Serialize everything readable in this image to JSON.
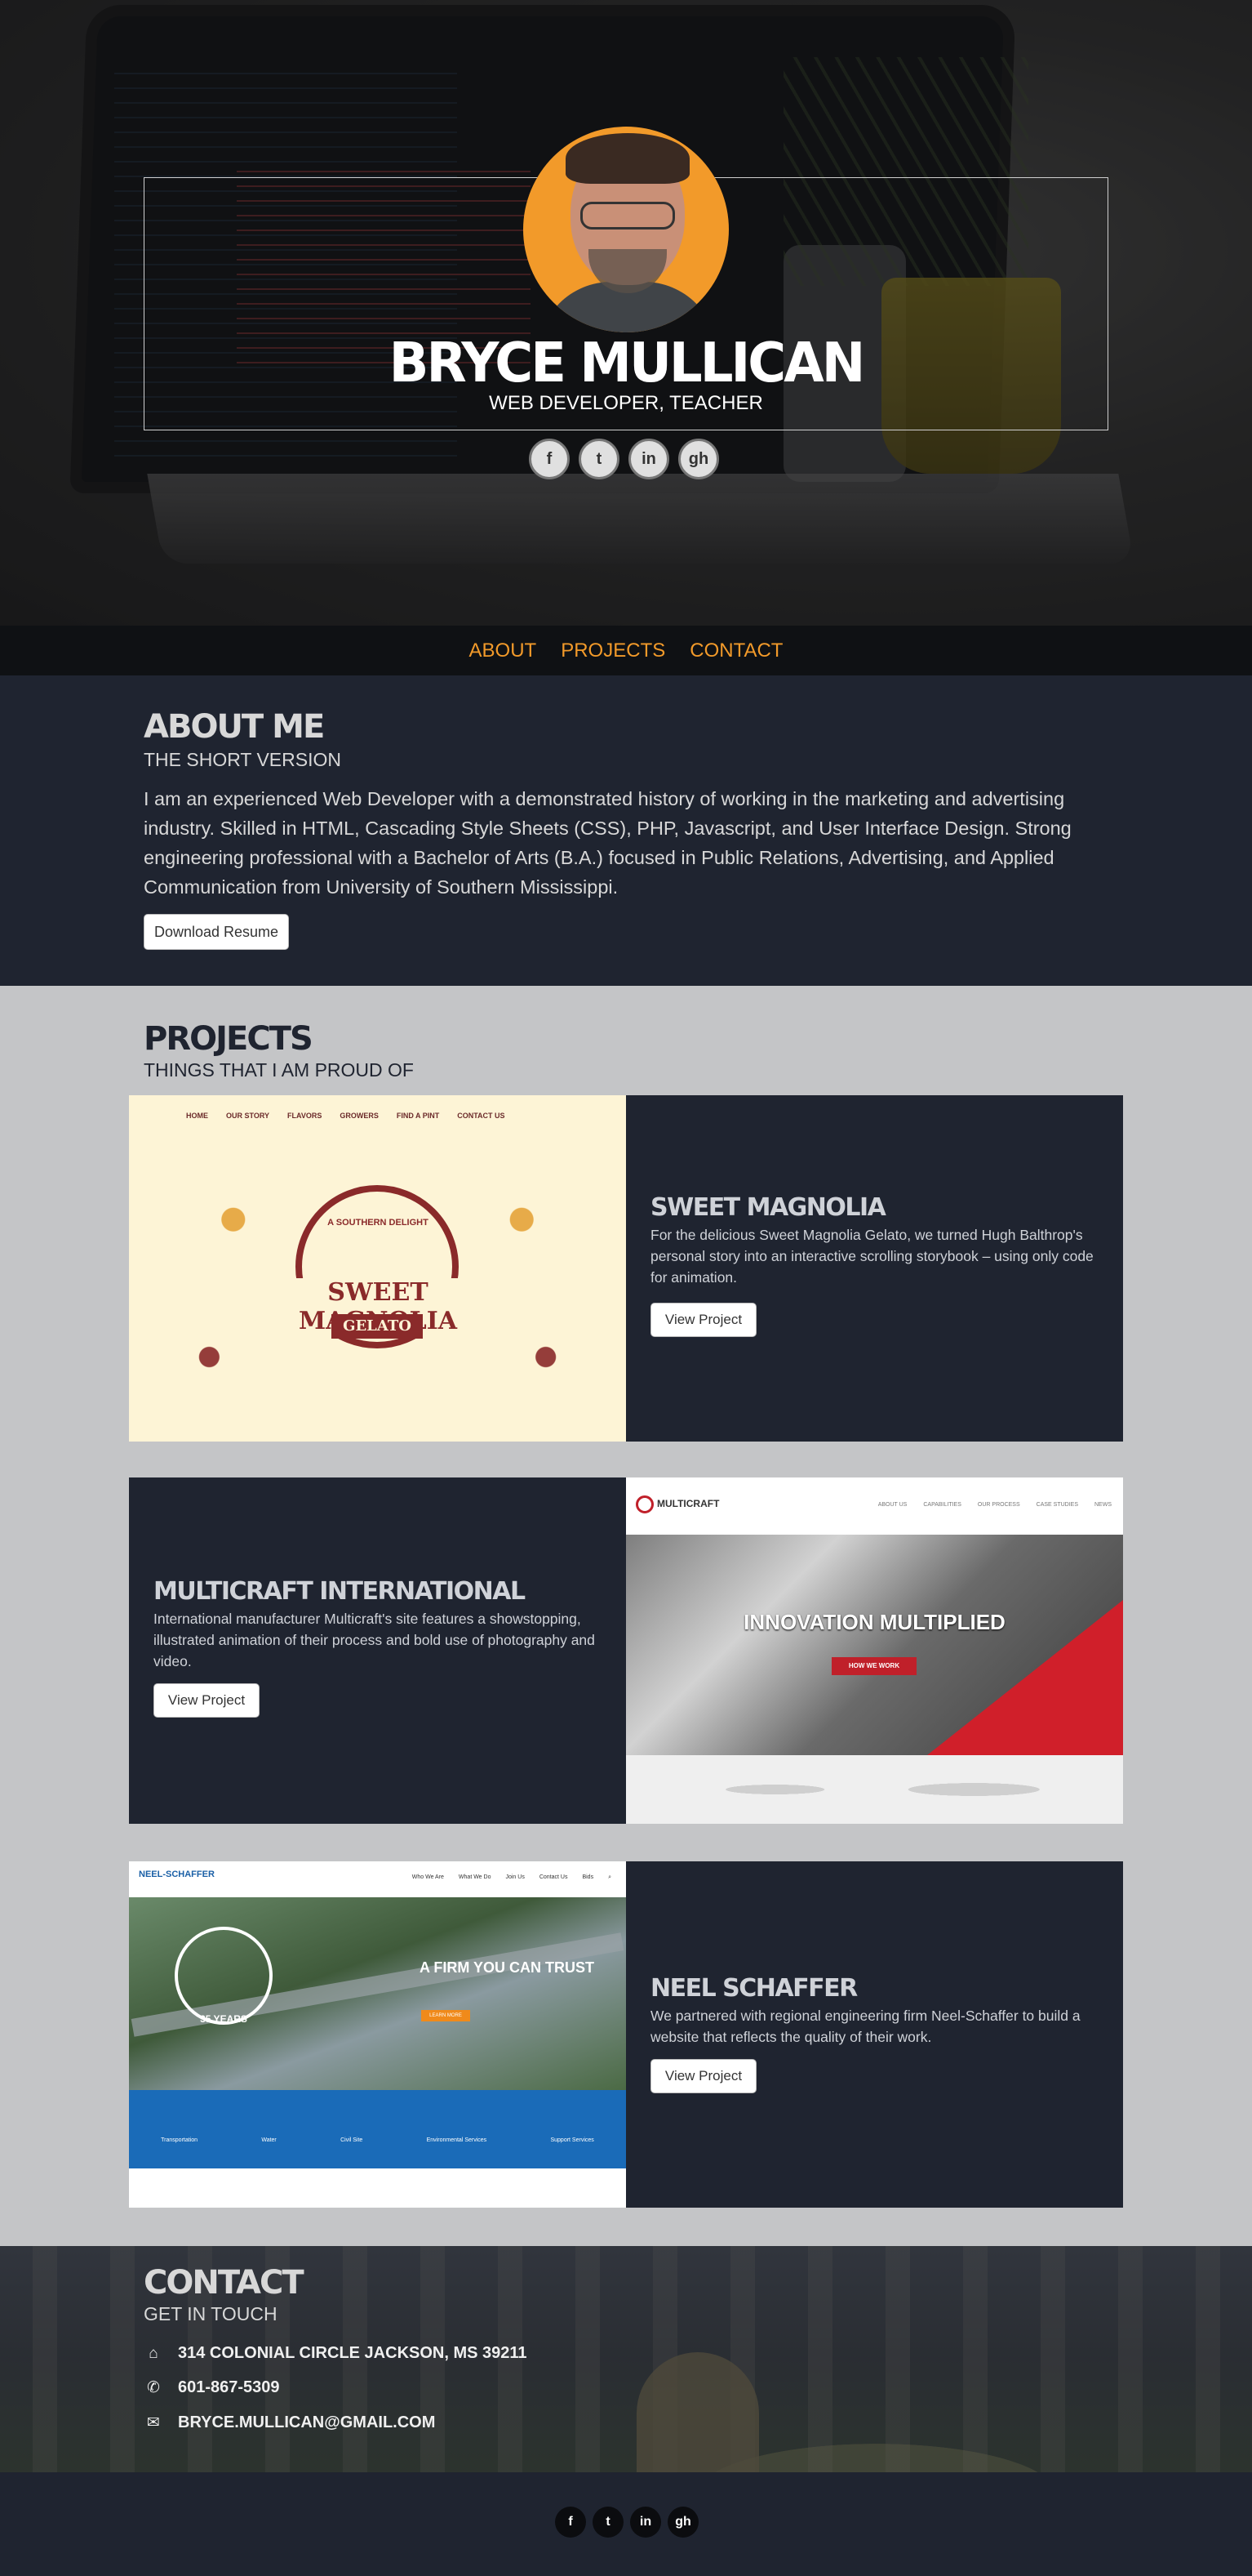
{
  "hero": {
    "name": "BRYCE MULLICAN",
    "subtitle": "WEB DEVELOPER, TEACHER",
    "social": [
      {
        "icon": "facebook-icon",
        "glyph": "f"
      },
      {
        "icon": "twitter-icon",
        "glyph": "t"
      },
      {
        "icon": "linkedin-icon",
        "glyph": "in"
      },
      {
        "icon": "github-icon",
        "glyph": "gh"
      }
    ]
  },
  "nav": {
    "items": [
      "ABOUT",
      "PROJECTS",
      "CONTACT"
    ]
  },
  "about": {
    "title": "ABOUT ME",
    "subtitle": "THE SHORT VERSION",
    "text": "I am an experienced Web Developer with a demonstrated history of working in the marketing and advertising industry. Skilled in HTML, Cascading Style Sheets (CSS), PHP, Javascript, and User Interface Design. Strong engineering professional with a Bachelor of Arts (B.A.) focused in Public Relations, Advertising, and Applied Communication from University of Southern Mississippi.",
    "button": "Download Resume"
  },
  "projects": {
    "title": "PROJECTS",
    "subtitle": "THINGS THAT I AM PROUD OF",
    "items": [
      {
        "title": "SWEET MAGNOLIA",
        "description": "For the delicious Sweet Magnolia Gelato, we turned Hugh Balthrop's personal story into an interactive scrolling storybook – using only code for animation.",
        "button": "View Project",
        "shot": {
          "nav": [
            "HOME",
            "OUR STORY",
            "FLAVORS",
            "GROWERS",
            "FIND A PINT",
            "CONTACT US"
          ],
          "delight": "A SOUTHERN DELIGHT",
          "name": "SWEET MAGNOLIA",
          "gelato": "GELATO"
        }
      },
      {
        "title": "MULTICRAFT INTERNATIONAL",
        "description": "International manufacturer Multicraft's site features a showstopping, illustrated animation of their process and bold use of photography and video.",
        "button": "View Project",
        "shot": {
          "logo": "MULTICRAFT",
          "menu": [
            "ABOUT US",
            "CAPABILITIES",
            "OUR PROCESS",
            "CASE STUDIES",
            "NEWS"
          ],
          "headline": "INNOVATION MULTIPLIED",
          "cta": "HOW WE WORK"
        }
      },
      {
        "title": "NEEL SCHAFFER",
        "description": "We partnered with regional engineering firm Neel-Schaffer to build a website that reflects the quality of their work.",
        "button": "View Project",
        "shot": {
          "logo": "NEEL-SCHAFFER",
          "menu": [
            "Who We Are",
            "What We Do",
            "Join Us",
            "Contact Us",
            "Bids"
          ],
          "headline": "A FIRM YOU CAN TRUST",
          "cta": "LEARN MORE",
          "years": "35 YEARS",
          "services": [
            "Transportation",
            "Water",
            "Civil Site",
            "Environmental Services",
            "Support Services"
          ]
        }
      }
    ]
  },
  "contact": {
    "title": "CONTACT",
    "subtitle": "GET IN TOUCH",
    "address": "314 COLONIAL CIRCLE JACKSON, MS 39211",
    "phone": "601-867-5309",
    "email": "BRYCE.MULLICAN@GMAIL.COM"
  },
  "colors": {
    "accent": "#f29a2a",
    "dark": "#1f2430",
    "light_bg": "#c4c5c7"
  }
}
